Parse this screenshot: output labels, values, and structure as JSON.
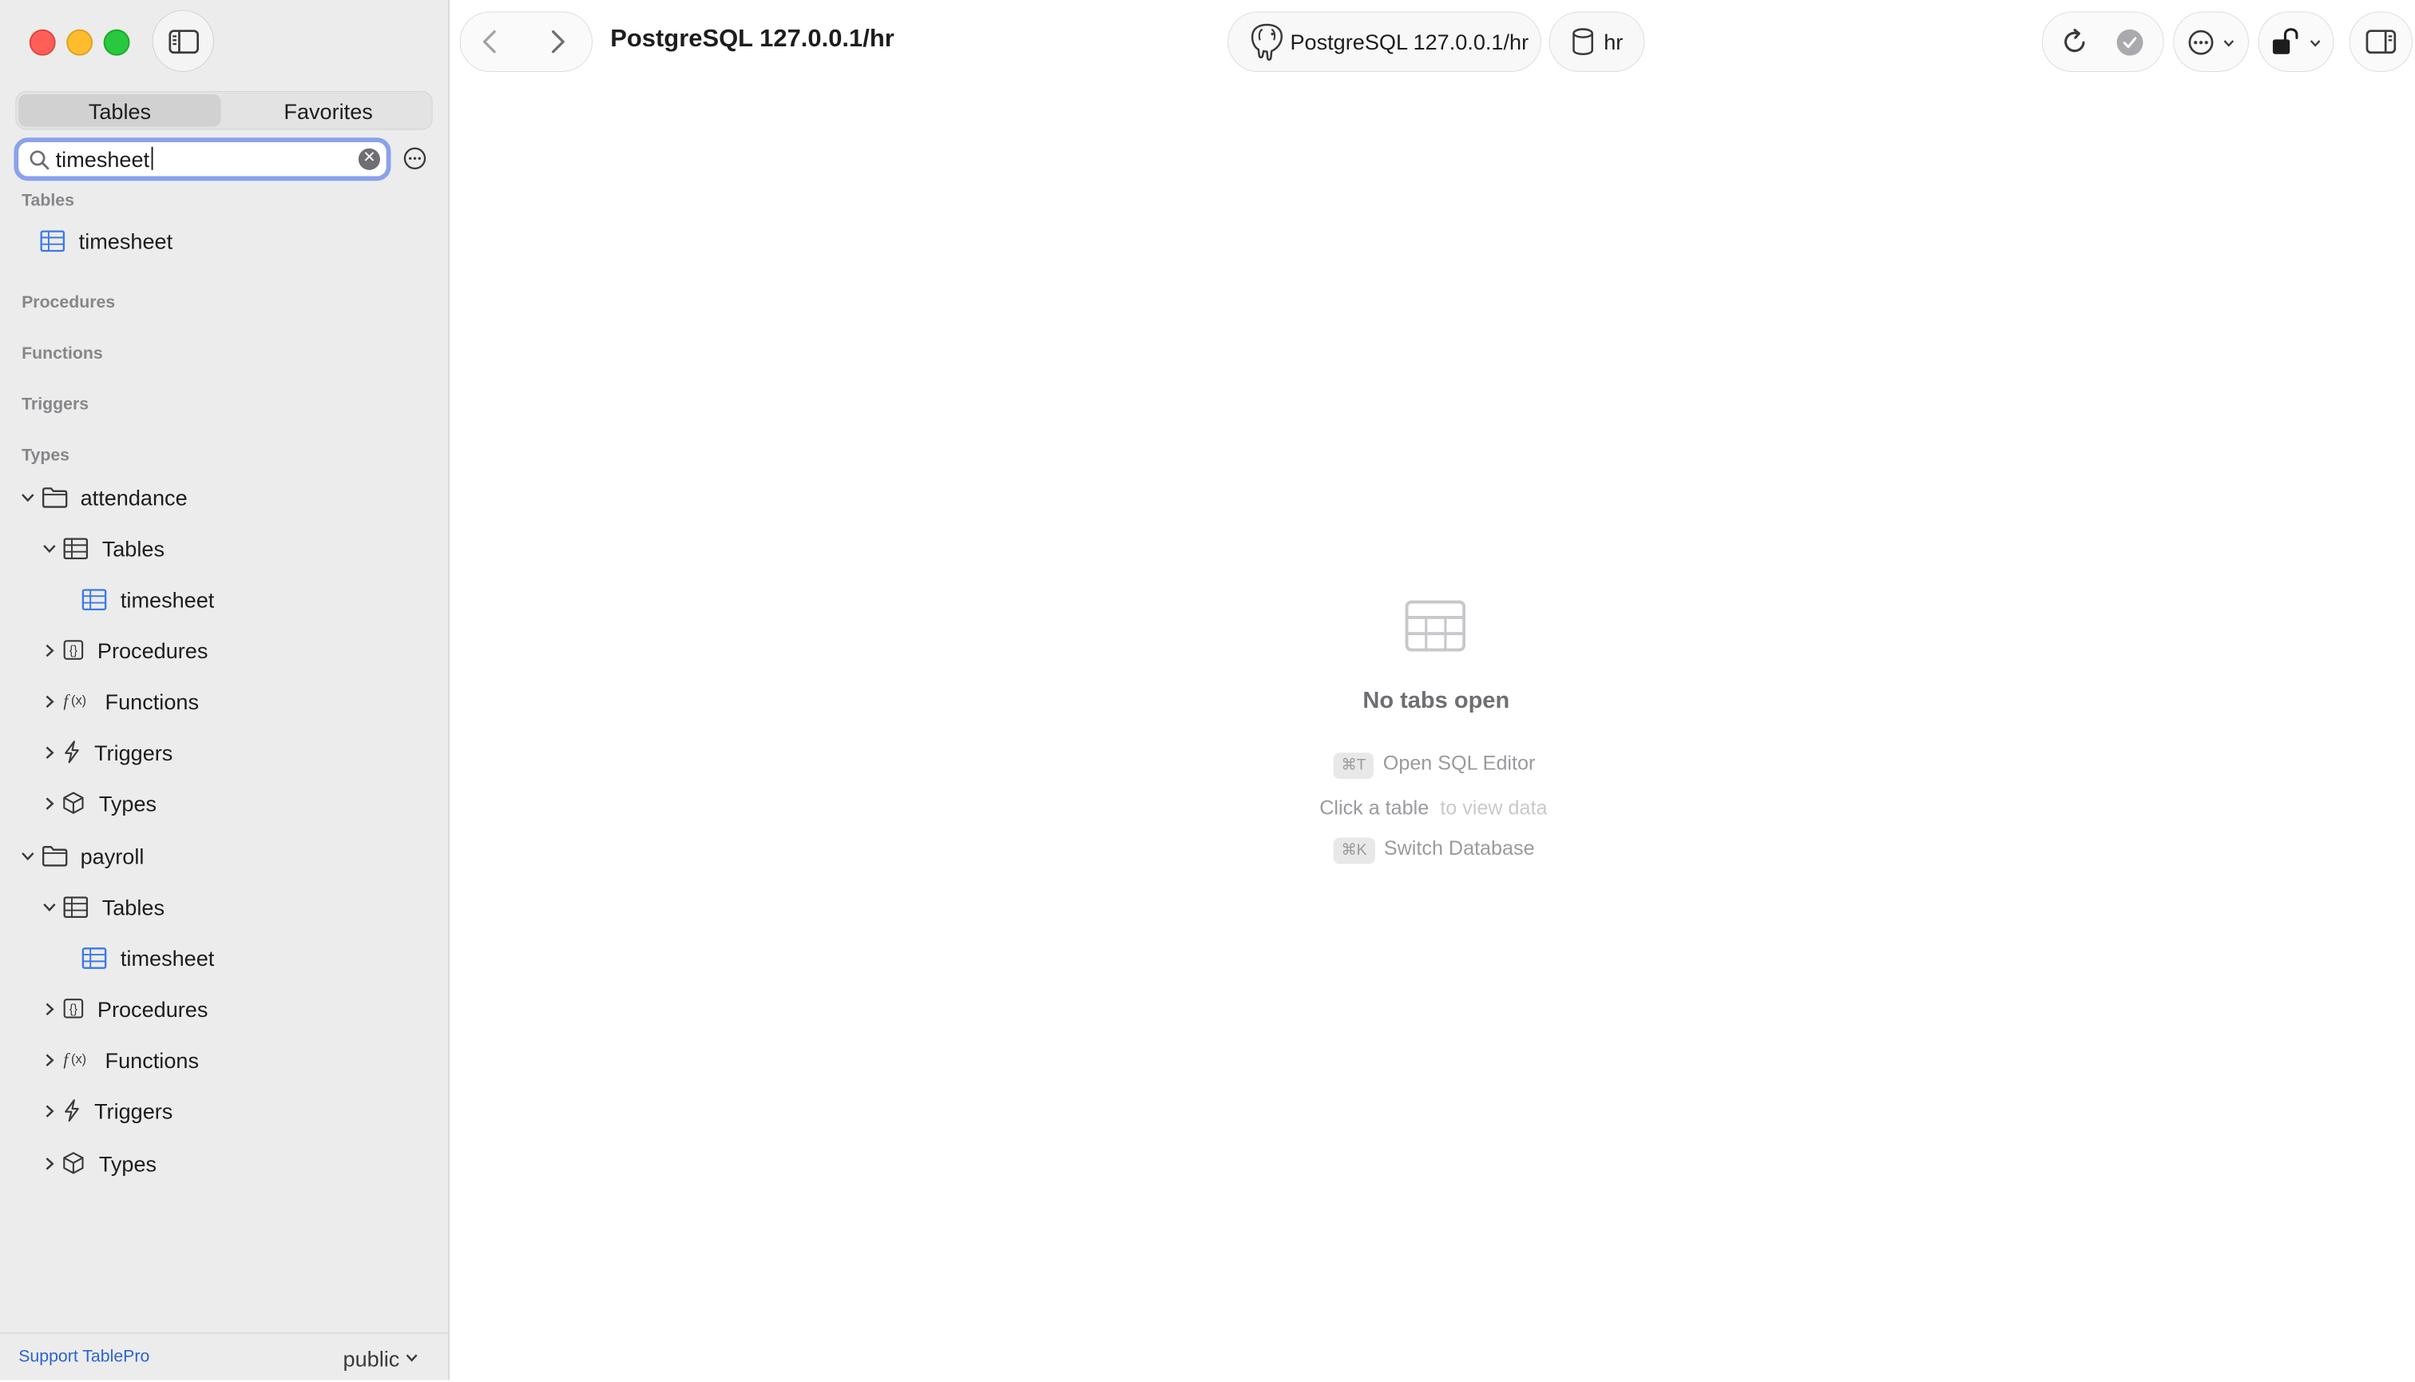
{
  "sidebar": {
    "segments": {
      "tables": "Tables",
      "favorites": "Favorites"
    },
    "search": {
      "value": "timesheet"
    },
    "sections": {
      "tables": "Tables",
      "procedures": "Procedures",
      "functions": "Functions",
      "triggers": "Triggers",
      "types": "Types"
    },
    "search_results": {
      "table": "timesheet"
    },
    "tree": {
      "attendance": {
        "name": "attendance",
        "tables": "Tables",
        "table_item": "timesheet",
        "procedures": "Procedures",
        "functions": "Functions",
        "triggers": "Triggers",
        "types": "Types"
      },
      "payroll": {
        "name": "payroll",
        "tables": "Tables",
        "table_item": "timesheet",
        "procedures": "Procedures",
        "functions": "Functions",
        "triggers": "Triggers",
        "types": "Types"
      }
    },
    "footer": {
      "support": "Support TablePro",
      "schema": "public"
    }
  },
  "toolbar": {
    "title": "PostgreSQL 127.0.0.1/hr",
    "connection": "PostgreSQL 127.0.0.1/hr",
    "database": "hr"
  },
  "empty_state": {
    "title": "No tabs open",
    "open_sql_key": "⌘T",
    "open_sql": "Open SQL Editor",
    "click_table": "Click a table",
    "click_table_suffix": "to view data",
    "switch_db_key": "⌘K",
    "switch_db": "Switch Database"
  },
  "colors": {
    "accent": "#2c63d6",
    "focus_ring": "#8aa2ec",
    "table_icon": "#3b78e7"
  }
}
